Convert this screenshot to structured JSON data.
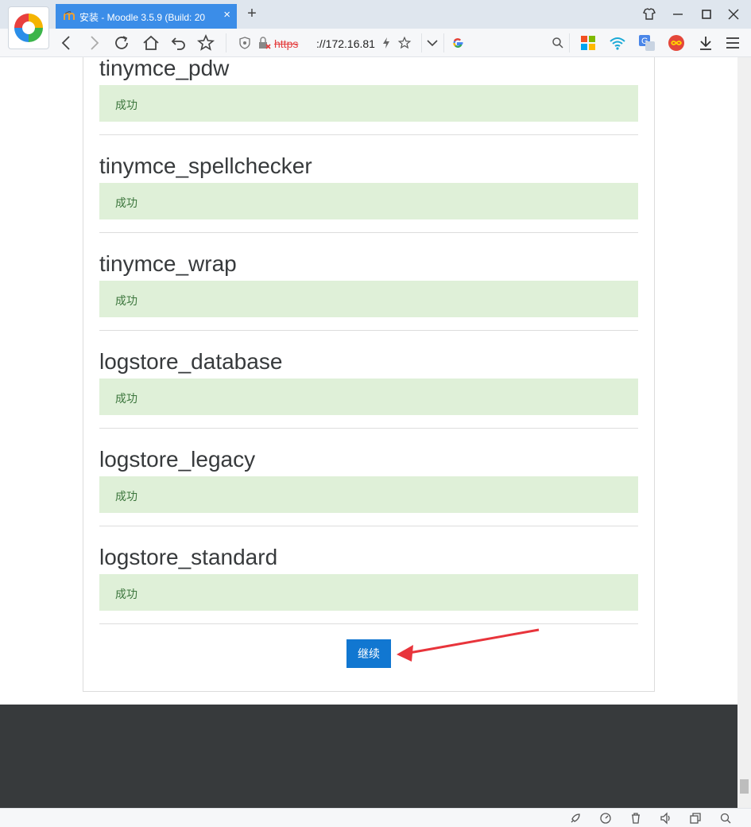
{
  "browser": {
    "tab": {
      "title": "安装 - Moodle 3.5.9 (Build: 20",
      "close": "×"
    },
    "new_tab": "+",
    "address": {
      "scheme": "https",
      "host": "://172.16.81"
    },
    "search": {
      "engine_icon": "google-icon"
    }
  },
  "page": {
    "plugins": [
      {
        "name": "tinymce_pdw",
        "status": "成功"
      },
      {
        "name": "tinymce_spellchecker",
        "status": "成功"
      },
      {
        "name": "tinymce_wrap",
        "status": "成功"
      },
      {
        "name": "logstore_database",
        "status": "成功"
      },
      {
        "name": "logstore_legacy",
        "status": "成功"
      },
      {
        "name": "logstore_standard",
        "status": "成功"
      }
    ],
    "continue_label": "继续"
  },
  "colors": {
    "success_bg": "#dff0d8",
    "success_text": "#3c763d",
    "primary_button": "#1177d1",
    "annotation_arrow": "#e8343b",
    "footer_bg": "#373a3c",
    "tab_active": "#3b8de8"
  }
}
